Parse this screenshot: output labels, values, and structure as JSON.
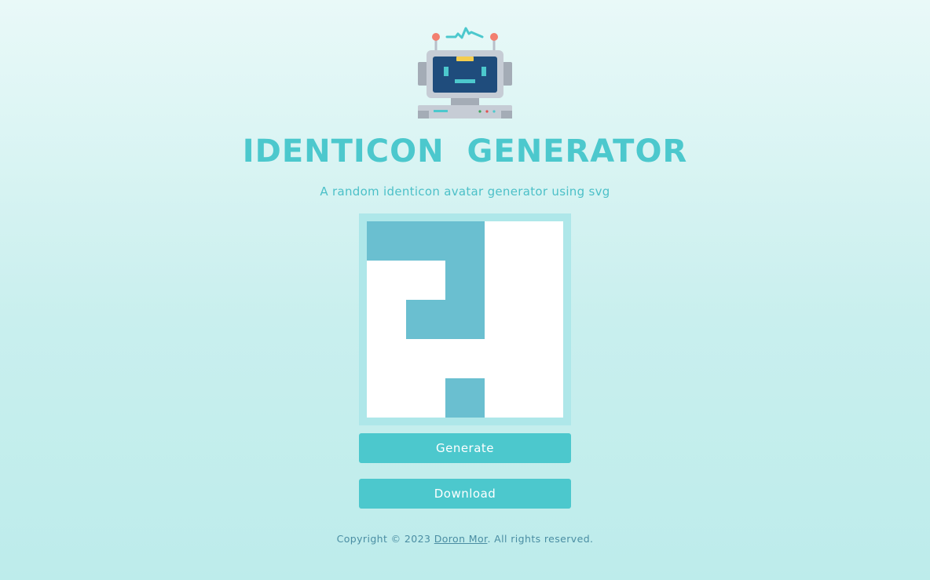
{
  "header": {
    "logo_icon": "robot-icon",
    "title": "IDENTICON GENERATOR",
    "subtitle": "A random identicon avatar generator using svg"
  },
  "identicon": {
    "fill_color": "#6abfd0",
    "background_color": "#ffffff",
    "frame_color": "#aee7e9",
    "grid_size": 5,
    "cells": [
      [
        1,
        1,
        1,
        0,
        0
      ],
      [
        0,
        0,
        1,
        0,
        0
      ],
      [
        0,
        1,
        1,
        0,
        0
      ],
      [
        0,
        0,
        0,
        0,
        0
      ],
      [
        0,
        0,
        1,
        0,
        0
      ]
    ]
  },
  "actions": {
    "generate_label": "Generate",
    "download_label": "Download",
    "button_color": "#4cc8cd"
  },
  "footer": {
    "prefix": "Copyright © 2023 ",
    "author_link": "Doron Mor",
    "suffix": ". All rights reserved."
  }
}
